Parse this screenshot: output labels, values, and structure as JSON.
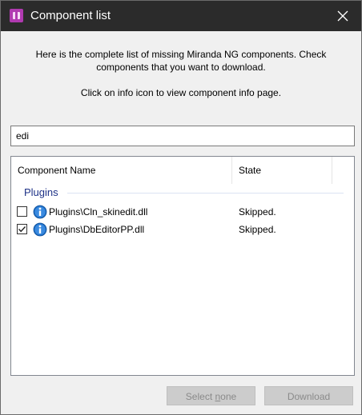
{
  "window": {
    "title": "Component list"
  },
  "description": {
    "line1": "Here is the complete list of missing Miranda NG components. Check components that you want to download.",
    "line2": "Click on info icon to view component info page."
  },
  "search": {
    "value": "edi"
  },
  "table": {
    "columns": [
      "Component Name",
      "State"
    ],
    "group": "Plugins",
    "rows": [
      {
        "name": "Plugins\\Cln_skinedit.dll",
        "state": "Skipped.",
        "checked": false
      },
      {
        "name": "Plugins\\DbEditorPP.dll",
        "state": "Skipped.",
        "checked": true
      }
    ]
  },
  "buttons": {
    "select_none_prefix": "Select ",
    "select_none_accel": "n",
    "select_none_suffix": "one",
    "download": "Download"
  },
  "colors": {
    "titlebar": "#2b2b2b",
    "group_text": "#1e3287",
    "info_icon": "#1f6fc5",
    "app_icon": "#b03ab0"
  },
  "icons": {
    "app": "puzzle-icon",
    "close": "close-icon",
    "info": "info-icon",
    "check": "checkmark-icon"
  }
}
